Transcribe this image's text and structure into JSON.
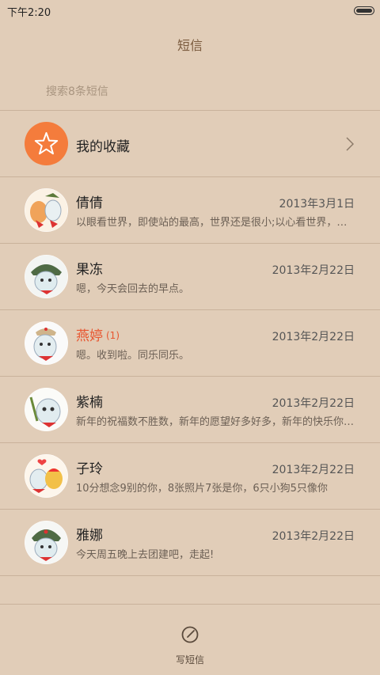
{
  "status_bar": {
    "time": "下午2:20"
  },
  "header": {
    "title": "短信"
  },
  "search": {
    "placeholder": "搜索8条短信"
  },
  "favorites": {
    "label": "我的收藏"
  },
  "messages": [
    {
      "name": "倩倩",
      "date": "2013年3月1日",
      "preview": "以眼看世界，即使站的最高，世界还是很小;以心看世界，即使站的最低，世界还是很大",
      "unread": false,
      "count": ""
    },
    {
      "name": "果冻",
      "date": "2013年2月22日",
      "preview": "嗯，今天会回去的早点。",
      "unread": false,
      "count": ""
    },
    {
      "name": "燕婷",
      "date": "2013年2月22日",
      "preview": "嗯。收到啦。同乐同乐。",
      "unread": true,
      "count": "(1)"
    },
    {
      "name": "紫楠",
      "date": "2013年2月22日",
      "preview": "新年的祝福数不胜数，新年的愿望好多好多，新年的快乐你我都有",
      "unread": false,
      "count": ""
    },
    {
      "name": "子玲",
      "date": "2013年2月22日",
      "preview": "10分想念9别的你，8张照片7张是你，6只小狗5只像你",
      "unread": false,
      "count": ""
    },
    {
      "name": "雅娜",
      "date": "2013年2月22日",
      "preview": "今天周五晚上去团建吧，走起!",
      "unread": false,
      "count": ""
    }
  ],
  "compose": {
    "label": "写短信"
  },
  "colors": {
    "background": "#e1cdb8",
    "accent": "#f47c3c",
    "unread": "#e8552f",
    "title": "#7b5b3e"
  }
}
